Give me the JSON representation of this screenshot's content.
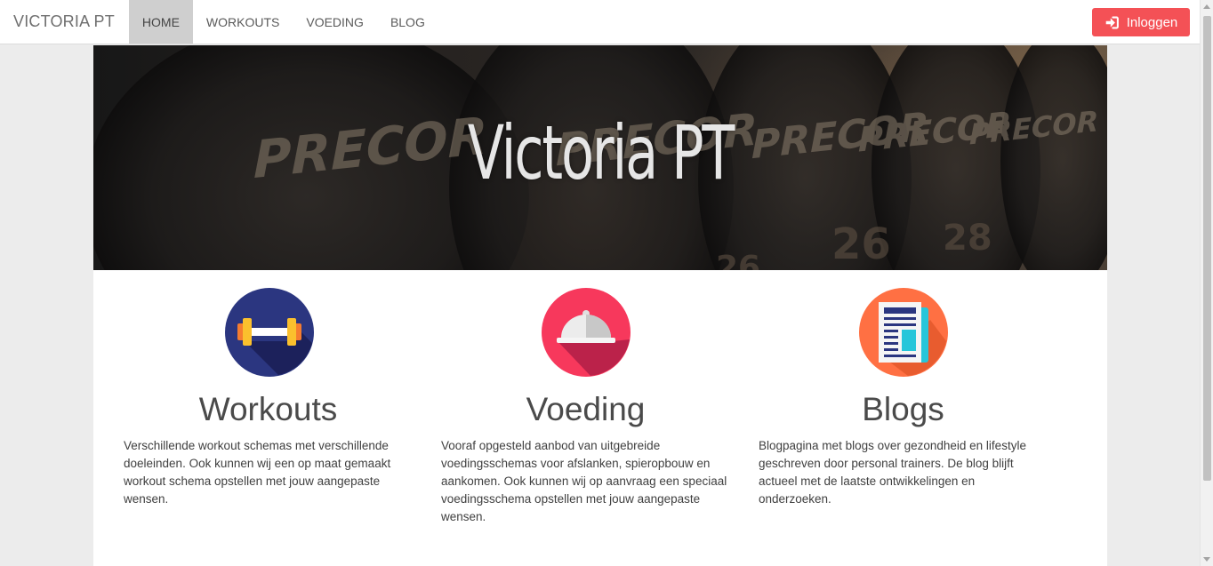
{
  "navbar": {
    "brand": "VICTORIA PT",
    "items": [
      {
        "label": "HOME",
        "active": true
      },
      {
        "label": "WORKOUTS",
        "active": false
      },
      {
        "label": "VOEDING",
        "active": false
      },
      {
        "label": "BLOG",
        "active": false
      }
    ],
    "login_label": "Inloggen",
    "login_icon": "sign-in-icon",
    "login_color": "#f45156"
  },
  "hero": {
    "title": "Victoria PT"
  },
  "features": [
    {
      "icon": "dumbbell-icon",
      "icon_color": "#2b3680",
      "title": "Workouts",
      "text": "Verschillende workout schemas met verschillende doeleinden. Ook kunnen wij een op maat gemaakt workout schema opstellen met jouw aangepaste wensen."
    },
    {
      "icon": "food-cloche-icon",
      "icon_color": "#f7385c",
      "title": "Voeding",
      "text": "Vooraf opgesteld aanbod van uitgebreide voedingsschemas voor afslanken, spieropbouw en aankomen. Ook kunnen wij op aanvraag een speciaal voedingsschema opstellen met jouw aangepaste wensen."
    },
    {
      "icon": "newspaper-icon",
      "icon_color": "#ff7043",
      "title": "Blogs",
      "text": "Blogpagina met blogs over gezondheid en lifestyle geschreven door personal trainers. De blog blijft actueel met de laatste ontwikkelingen en onderzoeken."
    }
  ]
}
